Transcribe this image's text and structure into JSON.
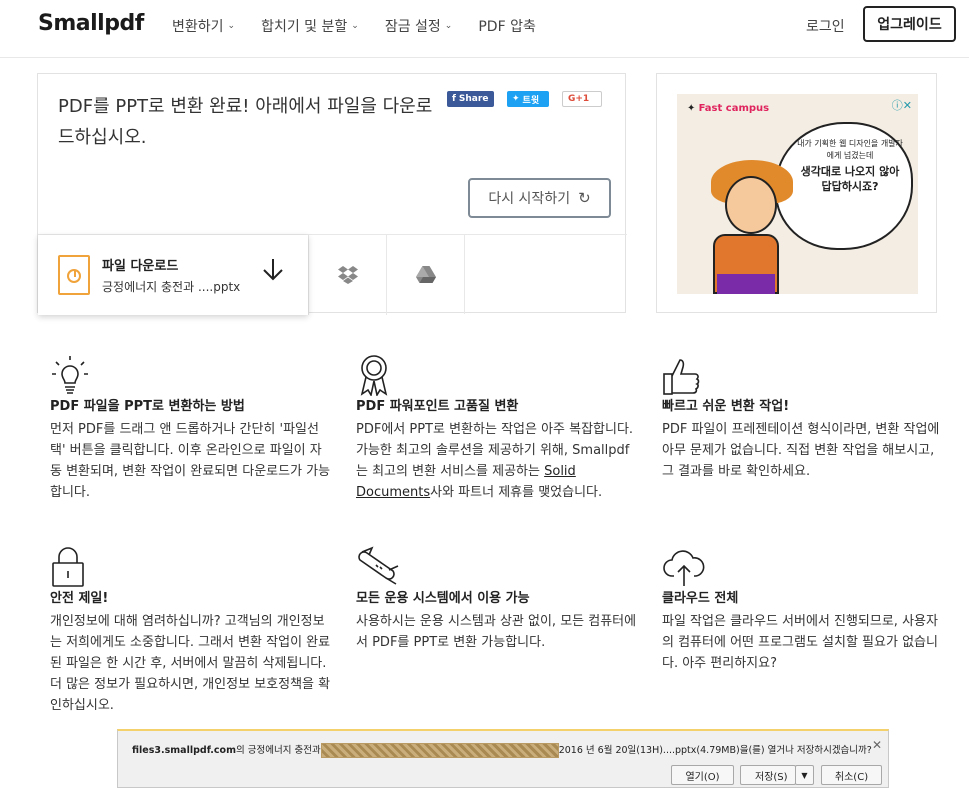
{
  "header": {
    "logo": "Smallpdf",
    "nav": [
      {
        "label": "변환하기"
      },
      {
        "label": "합치기 및 분할"
      },
      {
        "label": "잠금 설정"
      },
      {
        "label": "PDF 압축"
      }
    ],
    "login": "로그인",
    "upgrade": "업그레이드"
  },
  "result": {
    "message": "PDF를 PPT로 변환 완료! 아래에서 파일을 다운로드하십시오.",
    "social": {
      "facebook": "Share",
      "twitter": "트윗",
      "google": "G+1"
    },
    "restart": "다시 시작하기",
    "download": {
      "title": "파일 다운로드",
      "filename": "긍정에너지 충전과 ....pptx"
    }
  },
  "ad": {
    "brand": "Fast campus",
    "line1": "내가 기획한 웹 디자인을 개발자에게 넘겼는데",
    "line2": "생각대로 나오지 않아 답답하시죠?"
  },
  "features": [
    {
      "icon": "lightbulb-icon",
      "title": "PDF 파일을 PPT로 변환하는 방법",
      "body": "먼저 PDF를 드래그 앤 드롭하거나 간단히 '파일선택' 버튼을 클릭합니다. 이후 온라인으로 파일이 자동 변환되며, 변환 작업이 완료되면 다운로드가 가능합니다."
    },
    {
      "icon": "award-ribbon-icon",
      "title": "PDF 파워포인트 고품질 변환",
      "body_pre": "PDF에서 PPT로 변환하는 작업은 아주 복잡합니다. 가능한 최고의 솔루션을 제공하기 위해, Smallpdf는 최고의 변환 서비스를 제공하는 ",
      "body_link": "Solid Documents",
      "body_post": "사와 파트너 제휴를 맺었습니다."
    },
    {
      "icon": "thumbs-up-icon",
      "title": "빠르고 쉬운 변환 작업!",
      "body": "PDF 파일이 프레젠테이션 형식이라면, 변환 작업에 아무 문제가 없습니다. 직접 변환 작업을 해보시고, 그 결과를 바로 확인하세요."
    },
    {
      "icon": "lock-icon",
      "title": "안전 제일!",
      "body": "개인정보에 대해 염려하십니까? 고객님의 개인정보는 저희에게도 소중합니다. 그래서 변환 작업이 완료된 파일은 한 시간 후, 서버에서 말끔히 삭제됩니다. 더 많은 정보가 필요하시면, 개인정보 보호정책을 확인하십시오."
    },
    {
      "icon": "swiss-knife-icon",
      "title": "모든 운용 시스템에서 이용 가능",
      "body": "사용하시는 운용 시스템과 상관 없이, 모든 컴퓨터에서 PDF를 PPT로 변환 가능합니다."
    },
    {
      "icon": "cloud-upload-icon",
      "title": "클라우드 전체",
      "body": "파일 작업은 클라우드 서버에서 진행되므로, 사용자의 컴퓨터에 어떤 프로그램도 설치할 필요가 없습니다. 아주 편리하지요?"
    }
  ],
  "download_bar": {
    "host": "files3.smallpdf.com",
    "pre": "의 긍정에너지 충전과",
    "post": "2016 년 6월 20일(13H)....pptx",
    "size": "(4.79MB)",
    "question": "을(를) 열거나 저장하시겠습니까?",
    "open": "열기(O)",
    "save": "저장(S)",
    "cancel": "취소(C)"
  }
}
